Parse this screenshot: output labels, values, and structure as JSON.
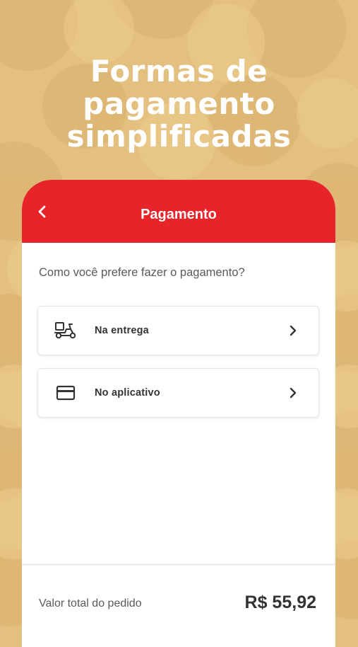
{
  "promo": {
    "headline_lines": [
      "Formas de",
      "pagamento",
      "simplificadas"
    ]
  },
  "colors": {
    "background": "#e3c07f",
    "pattern": "#d9b26c",
    "header": "#e8242b",
    "card": "#ffffff"
  },
  "header": {
    "back_icon": "chevron-left-icon",
    "title": "Pagamento"
  },
  "main": {
    "question": "Como você prefere fazer o pagamento?",
    "options": [
      {
        "label": "Na entrega",
        "icon": "delivery-scooter-icon"
      },
      {
        "label": "No aplicativo",
        "icon": "credit-card-icon"
      }
    ]
  },
  "footer": {
    "total_label": "Valor total do pedido",
    "total_value": "R$ 55,92"
  }
}
